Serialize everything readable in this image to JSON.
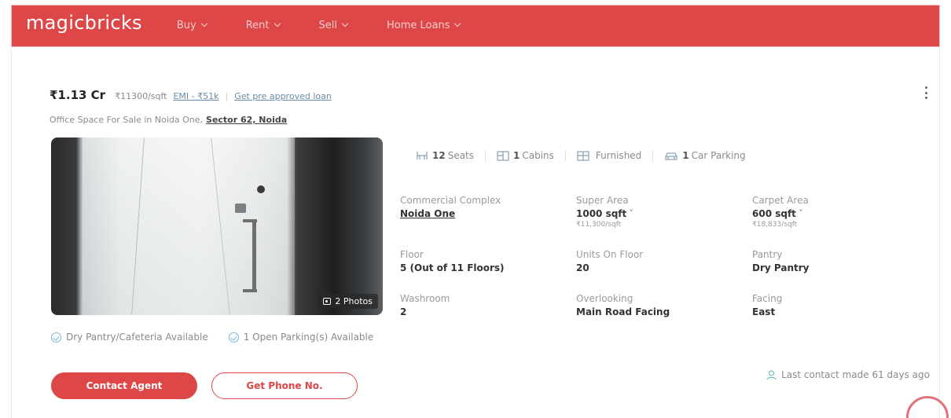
{
  "header": {
    "logo": "magicbricks",
    "nav": [
      {
        "label": "Buy"
      },
      {
        "label": "Rent"
      },
      {
        "label": "Sell"
      },
      {
        "label": "Home Loans"
      }
    ]
  },
  "listing": {
    "price": "₹1.13 Cr",
    "price_per_sqft": "₹11300/sqft",
    "emi": "EMI - ₹51k",
    "separator": "|",
    "loan_link": "Get pre approved loan",
    "subtitle": "Office Space For Sale in Noida One,",
    "locality": "Sector 62, Noida",
    "photos_label": "2 Photos",
    "amenities": [
      {
        "count": "12",
        "label": "Seats",
        "icon": "seats-icon"
      },
      {
        "count": "1",
        "label": "Cabins",
        "icon": "cabin-icon"
      },
      {
        "count": "",
        "label": "Furnished",
        "icon": "furnished-icon"
      },
      {
        "count": "1",
        "label": "Car Parking",
        "icon": "car-icon"
      }
    ],
    "specs": [
      {
        "label": "Commercial Complex",
        "value": "Noida One",
        "sub": ""
      },
      {
        "label": "Super Area",
        "value": "1000 sqft",
        "sub": "₹11,300/sqft"
      },
      {
        "label": "Carpet Area",
        "value": "600 sqft",
        "sub": "₹18,833/sqft"
      },
      {
        "label": "Floor",
        "value": "5 (Out of 11 Floors)",
        "sub": ""
      },
      {
        "label": "Units On Floor",
        "value": "20",
        "sub": ""
      },
      {
        "label": "Pantry",
        "value": "Dry Pantry",
        "sub": ""
      },
      {
        "label": "Washroom",
        "value": "2",
        "sub": ""
      },
      {
        "label": "Overlooking",
        "value": "Main Road Facing",
        "sub": ""
      },
      {
        "label": "Facing",
        "value": "East",
        "sub": ""
      }
    ],
    "highlights": [
      "Dry Pantry/Cafeteria Available",
      "1 Open Parking(s) Available"
    ],
    "contact_button": "Contact Agent",
    "phone_button": "Get Phone No.",
    "last_contact": "Last contact made 61 days ago"
  },
  "colors": {
    "brand": "#dd4748",
    "link": "#6a8aa8",
    "check": "#7ab7d8"
  }
}
